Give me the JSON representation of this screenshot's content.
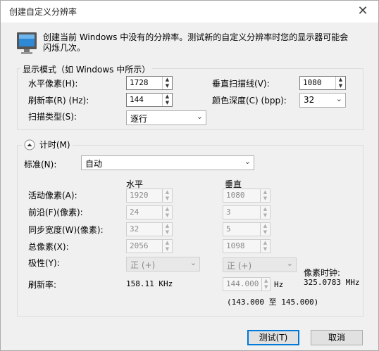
{
  "window": {
    "title": "创建自定义分辨率",
    "close_glyph": "✕"
  },
  "header": {
    "message_line1": "创建当前 Windows 中没有的分辨率。测试新的自定义分辨率时您的显示器可能会",
    "message_line2": "闪烁几次。"
  },
  "display_mode": {
    "group_title": "显示模式（如 Windows 中所示）",
    "h_pixels_label": "水平像素(H):",
    "h_pixels_value": "1728",
    "refresh_label": "刷新率(R) (Hz):",
    "refresh_value": "144",
    "scan_type_label": "扫描类型(S):",
    "scan_type_value": "逐行",
    "v_lines_label": "垂直扫描线(V):",
    "v_lines_value": "1080",
    "color_depth_label": "颜色深度(C) (bpp):",
    "color_depth_value": "32"
  },
  "timing": {
    "toggle_label": "计时(M)",
    "standard_label": "标准(N):",
    "standard_value": "自动",
    "col_horizontal": "水平",
    "col_vertical": "垂直",
    "active_label": "活动像素(A):",
    "active_h": "1920",
    "active_v": "1080",
    "front_label": "前沿(F)(像素):",
    "front_h": "24",
    "front_v": "3",
    "sync_label": "同步宽度(W)(像素):",
    "sync_h": "32",
    "sync_v": "5",
    "total_label": "总像素(X):",
    "total_h": "2056",
    "total_v": "1098",
    "polarity_label": "极性(Y):",
    "polarity_h": "正 (+)",
    "polarity_v": "正 (+)",
    "refresh_label": "刷新率:",
    "refresh_h": "158.11 KHz",
    "refresh_v": "144.000",
    "refresh_v_unit": "Hz",
    "refresh_range": "(143.000 至 145.000)",
    "pixel_clock_label": "像素时钟:",
    "pixel_clock_value": "325.0783 MHz"
  },
  "buttons": {
    "test": "测试(T)",
    "cancel": "取消"
  }
}
